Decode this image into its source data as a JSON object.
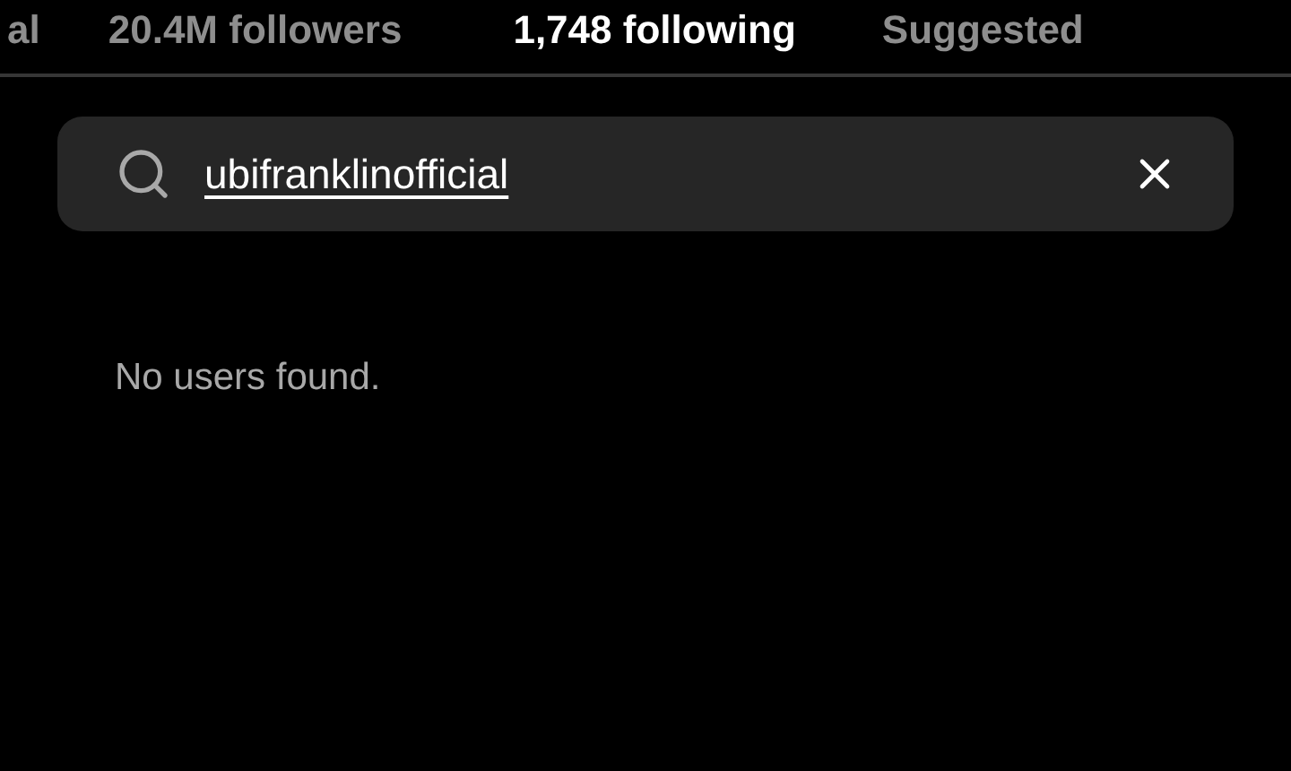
{
  "tabs": [
    {
      "label": "al",
      "selected": false
    },
    {
      "label": "20.4M followers",
      "selected": false
    },
    {
      "label": "1,748 following",
      "selected": true
    },
    {
      "label": "Suggested",
      "selected": false
    }
  ],
  "search": {
    "value": "ubifranklinofficial"
  },
  "message": "No users found."
}
